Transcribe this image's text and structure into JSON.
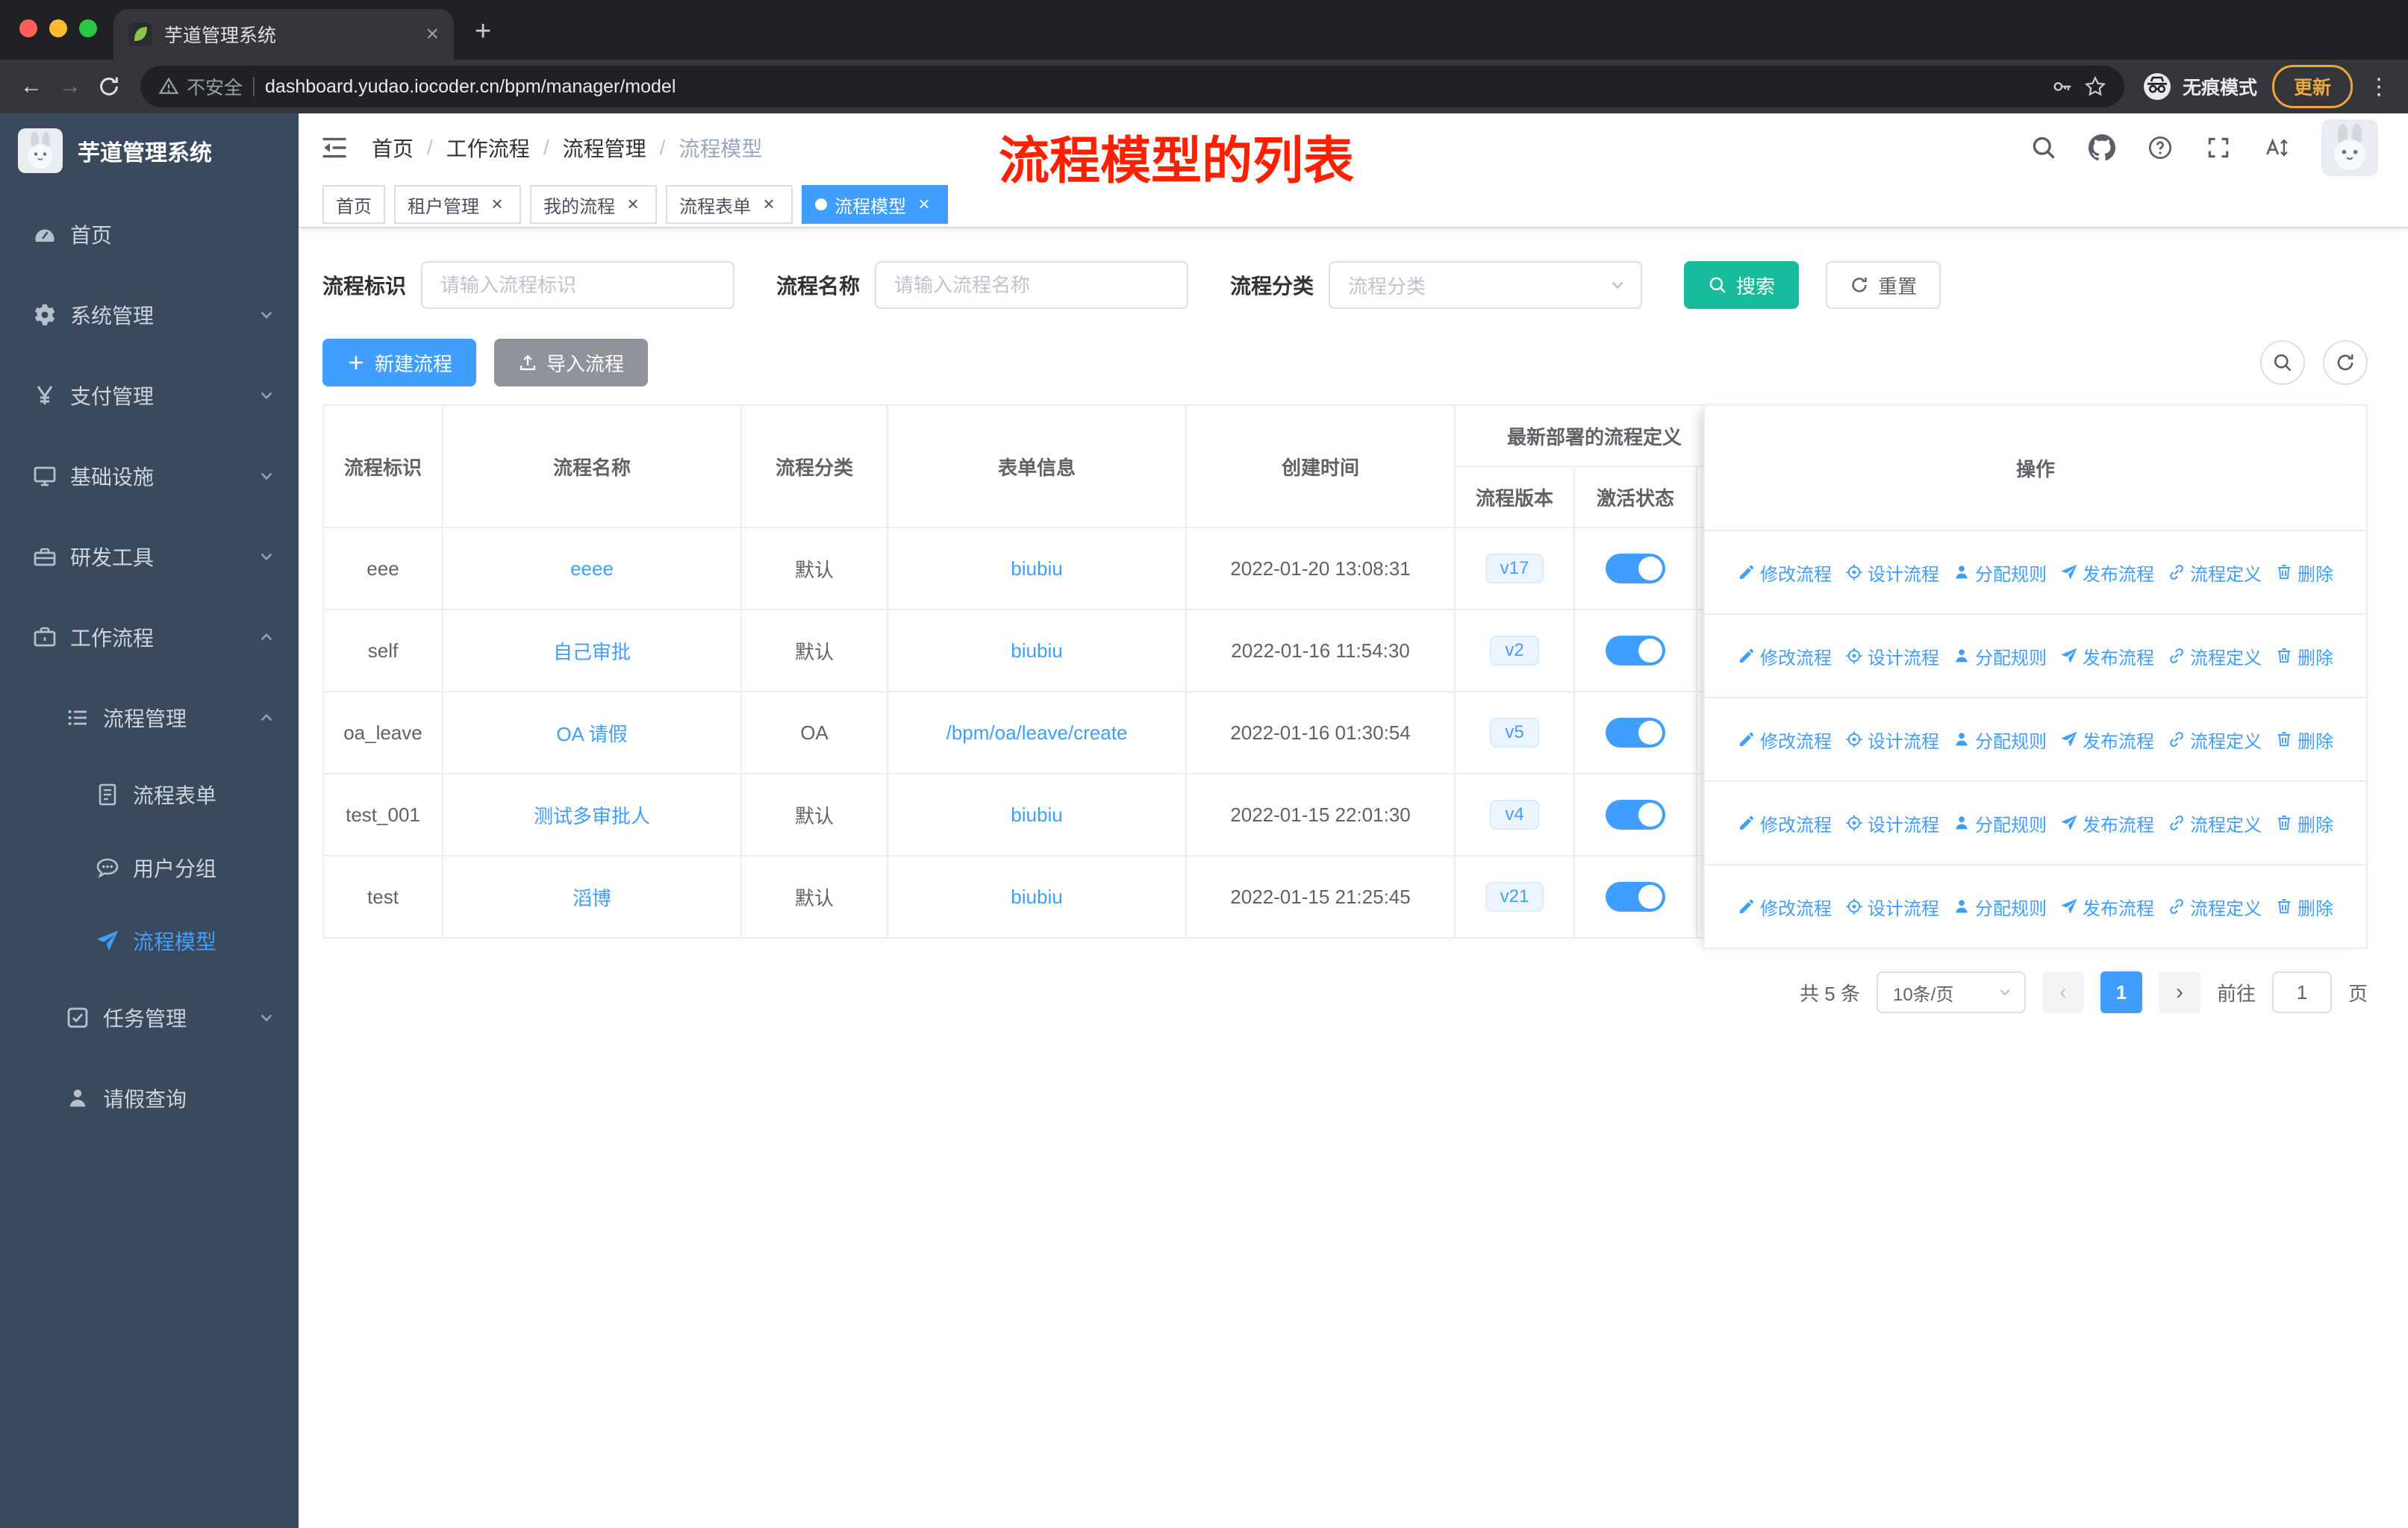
{
  "colors": {
    "primary": "#409EFF",
    "search_button": "#18BC9C",
    "sidebar_bg": "#3A4A5C",
    "annotation": "#FF2000",
    "link": "#409EFF"
  },
  "browser": {
    "tab_title": "芋道管理系统",
    "security_label": "不安全",
    "url": "dashboard.yudao.iocoder.cn/bpm/manager/model",
    "incognito_label": "无痕模式",
    "update_label": "更新"
  },
  "sidebar": {
    "logo_title": "芋道管理系统",
    "menu": [
      {
        "id": "home",
        "label": "首页",
        "icon": "dashboard",
        "level": 1
      },
      {
        "id": "system",
        "label": "系统管理",
        "icon": "gear",
        "level": 1,
        "arrow": "down"
      },
      {
        "id": "payment",
        "label": "支付管理",
        "icon": "yen",
        "level": 1,
        "arrow": "down"
      },
      {
        "id": "infra",
        "label": "基础设施",
        "icon": "monitor",
        "level": 1,
        "arrow": "down"
      },
      {
        "id": "devtools",
        "label": "研发工具",
        "icon": "tools",
        "level": 1,
        "arrow": "down"
      },
      {
        "id": "workflow",
        "label": "工作流程",
        "icon": "briefcase",
        "level": 1,
        "arrow": "up"
      },
      {
        "id": "process-mgmt",
        "label": "流程管理",
        "icon": "list",
        "level": 2,
        "arrow": "up"
      },
      {
        "id": "process-form",
        "label": "流程表单",
        "icon": "doc",
        "level": 3
      },
      {
        "id": "user-group",
        "label": "用户分组",
        "icon": "chat",
        "level": 3
      },
      {
        "id": "process-model",
        "label": "流程模型",
        "icon": "plane",
        "level": 3,
        "active": true
      },
      {
        "id": "task-mgmt",
        "label": "任务管理",
        "icon": "tasks",
        "level": 2,
        "arrow": "down"
      },
      {
        "id": "leave-query",
        "label": "请假查询",
        "icon": "person",
        "level": 2
      }
    ]
  },
  "header": {
    "breadcrumb": [
      "首页",
      "工作流程",
      "流程管理",
      "流程模型"
    ],
    "annotation": "流程模型的列表",
    "icons": [
      "search",
      "github",
      "question",
      "fullscreen",
      "font-size"
    ]
  },
  "tags": [
    {
      "id": "home",
      "label": "首页",
      "closable": false,
      "active": false
    },
    {
      "id": "tenant",
      "label": "租户管理",
      "closable": true,
      "active": false
    },
    {
      "id": "my-process",
      "label": "我的流程",
      "closable": true,
      "active": false
    },
    {
      "id": "process-form",
      "label": "流程表单",
      "closable": true,
      "active": false
    },
    {
      "id": "process-model",
      "label": "流程模型",
      "closable": true,
      "active": true
    }
  ],
  "filters": {
    "key_label": "流程标识",
    "key_placeholder": "请输入流程标识",
    "name_label": "流程名称",
    "name_placeholder": "请输入流程名称",
    "category_label": "流程分类",
    "category_placeholder": "流程分类",
    "search_label": "搜索",
    "reset_label": "重置"
  },
  "toolbar": {
    "create_label": "新建流程",
    "import_label": "导入流程",
    "icon_buttons": [
      "search",
      "refresh"
    ]
  },
  "table": {
    "columns": {
      "key": "流程标识",
      "name": "流程名称",
      "category": "流程分类",
      "form": "表单信息",
      "created": "创建时间",
      "group": "最新部署的流程定义",
      "version": "流程版本",
      "active": "激活状态",
      "ops": "操作"
    },
    "ops": [
      {
        "id": "modify",
        "label": "修改流程",
        "icon": "edit"
      },
      {
        "id": "design",
        "label": "设计流程",
        "icon": "aim"
      },
      {
        "id": "assign",
        "label": "分配规则",
        "icon": "user"
      },
      {
        "id": "publish",
        "label": "发布流程",
        "icon": "send"
      },
      {
        "id": "definition",
        "label": "流程定义",
        "icon": "link"
      },
      {
        "id": "delete",
        "label": "删除",
        "icon": "trash"
      }
    ],
    "rows": [
      {
        "key": "eee",
        "name": "eeee",
        "category": "默认",
        "form": "biubiu",
        "created": "2022-01-20 13:08:31",
        "version": "v17",
        "active": true
      },
      {
        "key": "self",
        "name": "自己审批",
        "category": "默认",
        "form": "biubiu",
        "created": "2022-01-16 11:54:30",
        "version": "v2",
        "active": true
      },
      {
        "key": "oa_leave",
        "name": "OA 请假",
        "category": "OA",
        "form": "/bpm/oa/leave/create",
        "created": "2022-01-16 01:30:54",
        "version": "v5",
        "active": true
      },
      {
        "key": "test_001",
        "name": "测试多审批人",
        "category": "默认",
        "form": "biubiu",
        "created": "2022-01-15 22:01:30",
        "version": "v4",
        "active": true
      },
      {
        "key": "test",
        "name": "滔博",
        "category": "默认",
        "form": "biubiu",
        "created": "2022-01-15 21:25:45",
        "version": "v21",
        "active": true
      }
    ]
  },
  "pagination": {
    "total": "共 5 条",
    "page_size": "10条/页",
    "page": "1",
    "goto_label": "前往",
    "goto_value": "1",
    "unit_label": "页"
  }
}
